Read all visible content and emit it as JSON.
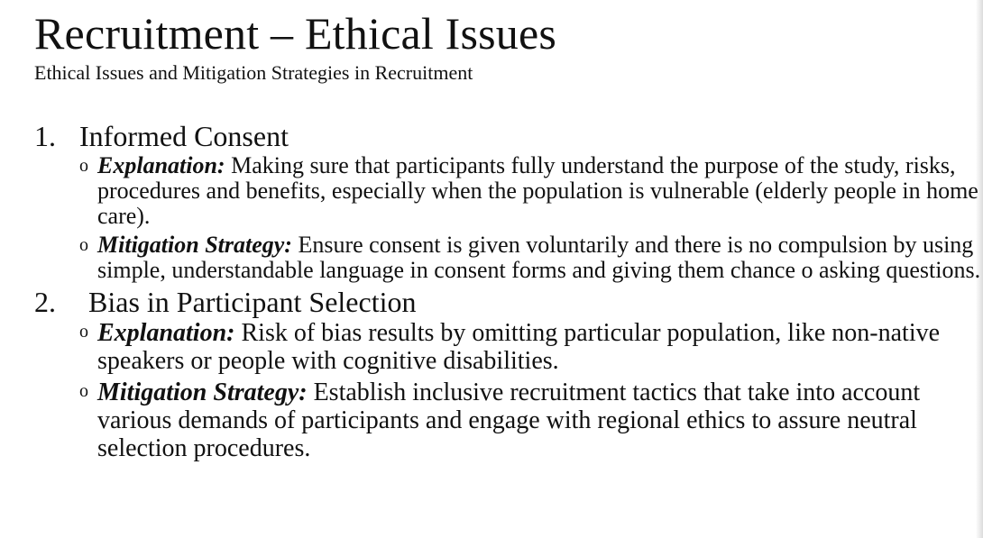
{
  "header": {
    "title": "Recruitment – Ethical Issues",
    "subtitle": "Ethical Issues and Mitigation Strategies in Recruitment"
  },
  "sections": [
    {
      "number": "1.",
      "title": "Informed Consent",
      "bullets": [
        {
          "marker": "o",
          "label": "Explanation:",
          "text": " Making sure that participants fully understand the purpose of the study, risks, procedures and benefits, especially when the population is vulnerable (elderly people in home care)."
        },
        {
          "marker": "o",
          "label": "Mitigation Strategy:",
          "text": " Ensure consent is given voluntarily and there is no compulsion by using simple, understandable language in consent forms and giving them chance o asking questions."
        }
      ]
    },
    {
      "number": "2.",
      "title": "Bias in Participant Selection",
      "bullets": [
        {
          "marker": "o",
          "label": "Explanation:",
          "text": " Risk of bias results by omitting particular population, like non-native speakers or people with cognitive disabilities."
        },
        {
          "marker": "o",
          "label": "Mitigation Strategy:",
          "text": " Establish inclusive recruitment tactics that take into account various demands of participants and engage with regional ethics to assure neutral selection procedures."
        }
      ]
    }
  ]
}
